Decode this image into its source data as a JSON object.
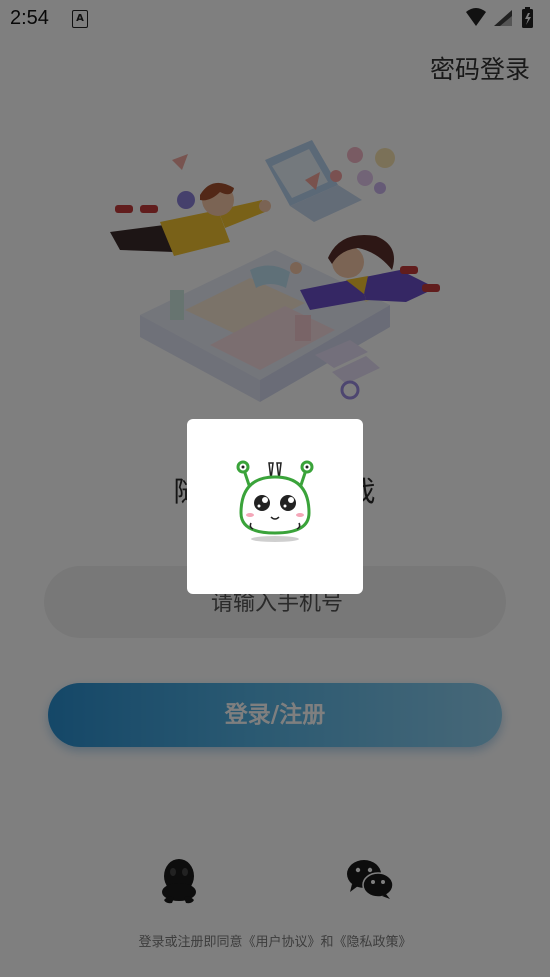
{
  "status_bar": {
    "time": "2:54",
    "notification_glyph": "A",
    "icons": [
      "wifi-icon",
      "signal-icon",
      "battery-charging-icon"
    ]
  },
  "header": {
    "password_login_label": "密码登录"
  },
  "hero": {
    "illustration": "two-people-flying-illustration"
  },
  "slogan": "随时随地玩游戏",
  "phone_field": {
    "value": "",
    "placeholder": "请输入手机号"
  },
  "login_button_label": "登录/注册",
  "third_party": {
    "qq_icon": "qq-icon",
    "wechat_icon": "wechat-icon"
  },
  "agreement_text": "登录或注册即同意《用户协议》和《隐私政策》",
  "loading_dialog": {
    "icon": "loading-mascot-icon"
  },
  "colors": {
    "accent_gradient_start": "#2a8fd0",
    "accent_gradient_end": "#8fd0f0",
    "overlay": "rgba(0,0,0,0.5)",
    "mascot_green": "#3aa33a"
  }
}
